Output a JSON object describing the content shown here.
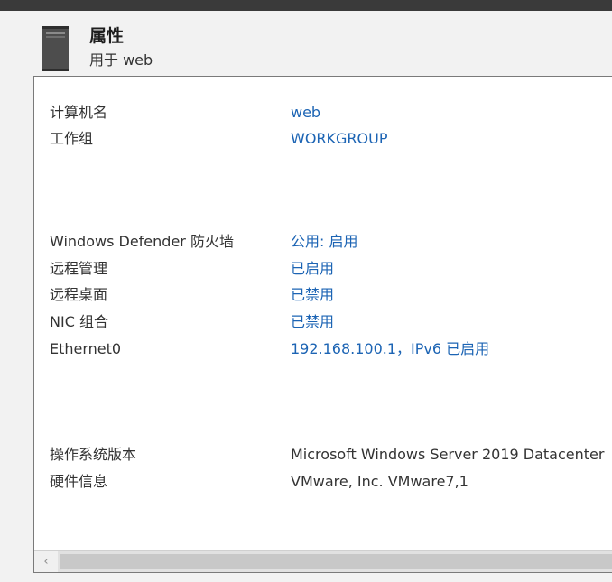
{
  "header": {
    "title": "属性",
    "subtitle": "用于 web",
    "icon": "server-tower-icon"
  },
  "properties": {
    "computer_name": {
      "label": "计算机名",
      "value": "web"
    },
    "workgroup": {
      "label": "工作组",
      "value": "WORKGROUP"
    },
    "firewall": {
      "label": "Windows Defender 防火墙",
      "value": "公用: 启用"
    },
    "remote_management": {
      "label": "远程管理",
      "value": "已启用"
    },
    "remote_desktop": {
      "label": "远程桌面",
      "value": "已禁用"
    },
    "nic_teaming": {
      "label": "NIC 组合",
      "value": "已禁用"
    },
    "ethernet0": {
      "label": "Ethernet0",
      "value": "192.168.100.1，IPv6 已启用"
    },
    "os_version": {
      "label": "操作系统版本",
      "value": "Microsoft Windows Server 2019 Datacenter"
    },
    "hardware": {
      "label": "硬件信息",
      "value": "VMware, Inc. VMware7,1"
    }
  },
  "scrollbar": {
    "left_arrow": "‹"
  },
  "colors": {
    "link": "#1c64b4",
    "text": "#333333",
    "topbar": "#3a3a3a",
    "background": "#f2f2f2"
  }
}
